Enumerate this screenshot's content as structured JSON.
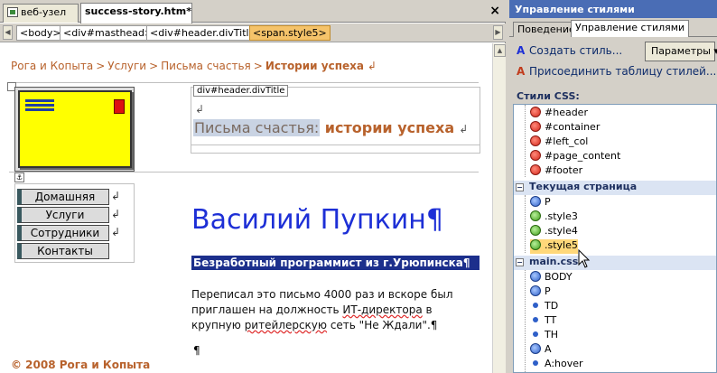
{
  "editor": {
    "tabs": [
      {
        "label": "веб-узел"
      },
      {
        "label": "success-story.htm*"
      }
    ],
    "tag_breadcrumbs": [
      "<body>",
      "<div#masthead>",
      "<div#header.divTitle>",
      "<span.style5>"
    ],
    "page": {
      "breadcrumb": {
        "items": [
          "Рога и Копыта",
          "Услуги",
          "Письма счастья"
        ],
        "current": "Истории успеха",
        "separator": ">",
        "mark": "↲"
      },
      "header_label": "div#header.divTitle",
      "header_para_mark": "↲",
      "header_title_part1": "Письма счастья:",
      "header_title_part2": " истории успеха",
      "header_title_mark": "↲",
      "menu": [
        "Домашняя",
        "Услуги",
        "Сотрудники",
        "Контакты"
      ],
      "menu_mark": "↲",
      "name_heading": "Василий Пупкин¶",
      "subtitle": "Безработный программист из г.Урюпинска¶",
      "body": {
        "p1": "Переписал это письмо 4000 раз и вскоре был приглашен на должность ",
        "p1_link": "ИТ-директора",
        "p2": " в крупную ",
        "p2_squig": "ритейлерскую",
        "p3": " сеть \"Не Ждали\".¶"
      },
      "empty_para": "¶",
      "footer": "© 2008 Рога и Копыта"
    }
  },
  "panel": {
    "title": "Управление стилями",
    "tabs": [
      "Поведение",
      "Управление стилями"
    ],
    "new_style": "Создать стиль...",
    "options_button": "Параметры",
    "attach_stylesheet": "Присоединить таблицу стилей...",
    "css_styles_label": "Стили CSS:",
    "groups": [
      {
        "name": null,
        "items": [
          "#header",
          "#container",
          "#left_col",
          "#page_content",
          "#footer"
        ]
      },
      {
        "name": "Текущая страница",
        "items": [
          "P",
          ".style3",
          ".style4",
          ".style5"
        ]
      },
      {
        "name": "main.css",
        "items": [
          "BODY",
          "P",
          "TD",
          "TT",
          "TH",
          "A",
          "A:hover"
        ]
      }
    ],
    "selected_style": ".style5",
    "colors": {
      "accent": "#4a6db5",
      "selection": "#ffd87a",
      "heading_blue": "#1d2fd6",
      "brand_orange": "#b8622c"
    }
  }
}
